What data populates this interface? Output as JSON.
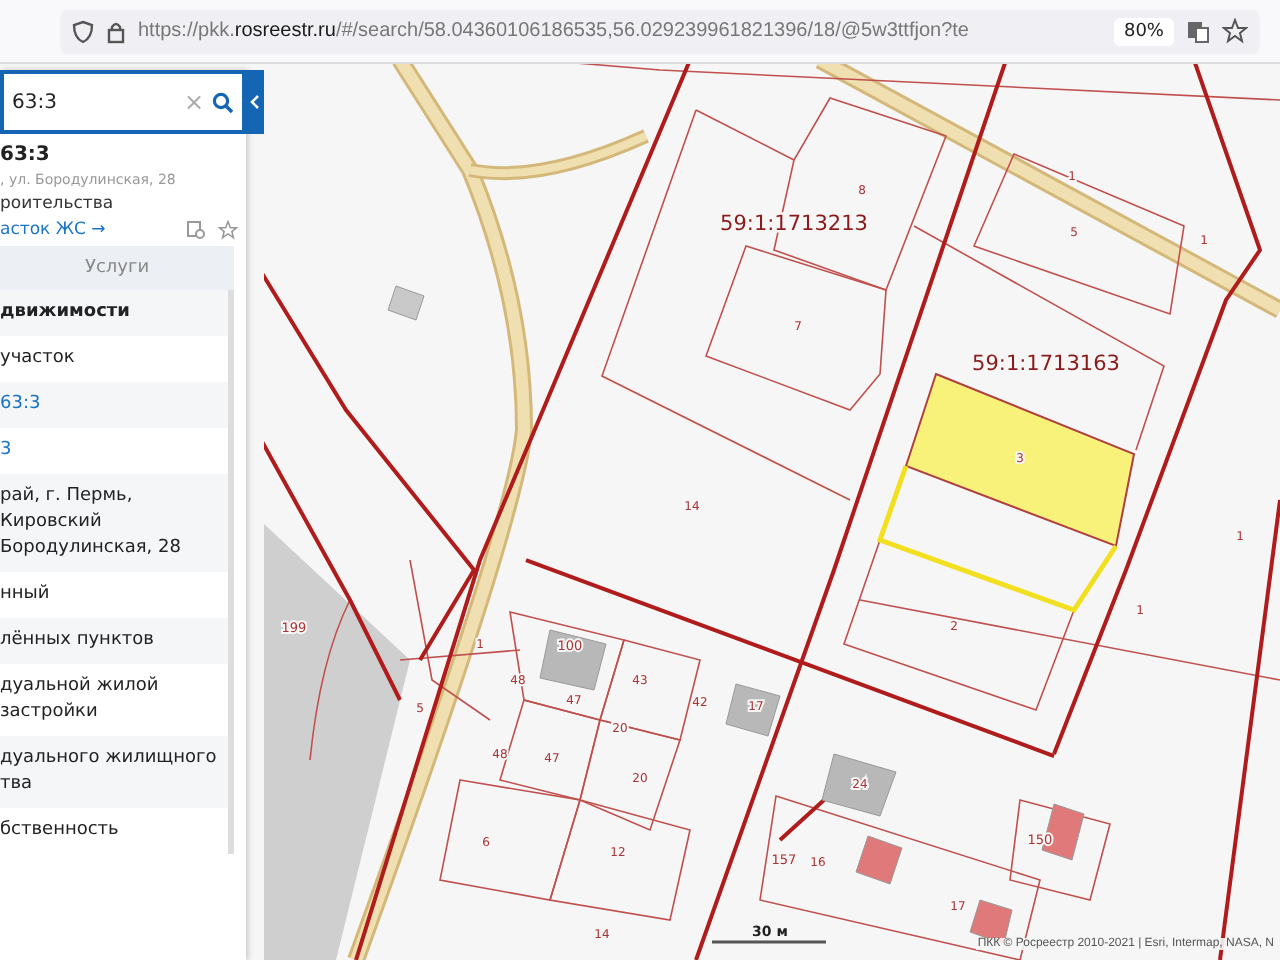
{
  "browser": {
    "url_host_prefix": "https://pkk.",
    "url_host": "rosreestr.ru",
    "url_rest": "/#/search/58.04360106186535,56.029239961821396/18/@5w3ttfjon?te",
    "zoom": "80%"
  },
  "sidebar": {
    "search": {
      "value": "63:3",
      "clear": "×"
    },
    "card": {
      "title": "63:3",
      "address": ", ул. Бородулинская, 28",
      "category": "роительства",
      "link": "асток ЖС →"
    },
    "tab": "Услуги",
    "rows": [
      {
        "kind": "header",
        "text": "движимости"
      },
      {
        "kind": "text",
        "text": "участок"
      },
      {
        "kind": "link",
        "text": "63:3"
      },
      {
        "kind": "link",
        "text": "3"
      },
      {
        "kind": "text",
        "text": "рай, г. Пермь, Кировский Бородулинская, 28"
      },
      {
        "kind": "text",
        "text": "нный"
      },
      {
        "kind": "text",
        "text": "лённых пунктов"
      },
      {
        "kind": "text",
        "text": "дуальной жилой застройки"
      },
      {
        "kind": "text",
        "text": "дуального жилищного тва"
      },
      {
        "kind": "text",
        "text": "бственность"
      }
    ]
  },
  "map": {
    "quarters": [
      "59:1:1713213",
      "59:1:1713163"
    ],
    "parcel_numbers": [
      "8",
      "7",
      "5",
      "1",
      "1",
      "3",
      "14",
      "1",
      "199",
      "100",
      "43",
      "42",
      "17",
      "48",
      "47",
      "20",
      "48",
      "47",
      "20",
      "5",
      "1",
      "2",
      "1",
      "24",
      "6",
      "12",
      "157",
      "16",
      "150",
      "17",
      "14"
    ],
    "scale": "30 м",
    "attribution": "ПКК © Росреестр 2010-2021 | Esri, Intermap, NASA, N"
  }
}
